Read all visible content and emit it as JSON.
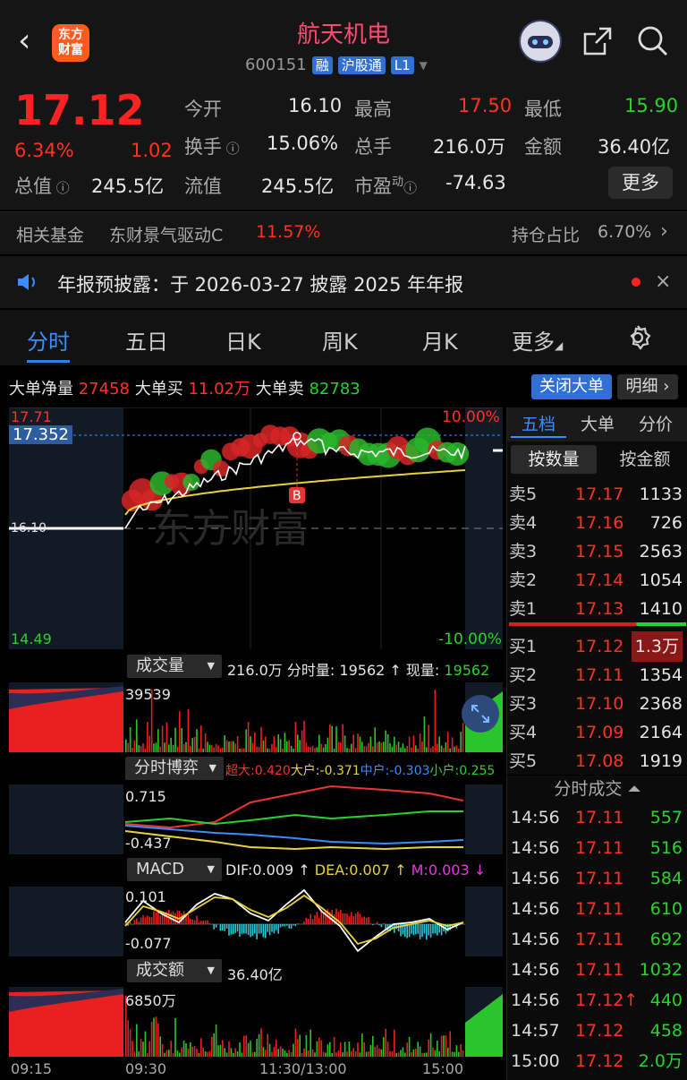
{
  "header": {
    "name": "航天机电",
    "code": "600151",
    "tags": [
      "融",
      "沪股通",
      "L1"
    ],
    "logo_text": "东方财富"
  },
  "quote": {
    "price": "17.12",
    "pct": "6.34%",
    "chg": "1.02",
    "open_l": "今开",
    "open": "16.10",
    "high_l": "最高",
    "high": "17.50",
    "low_l": "最低",
    "low": "15.90",
    "turn_l": "换手",
    "turn": "15.06%",
    "vol_l": "总手",
    "vol": "216.0万",
    "amt_l": "金额",
    "amt": "36.40亿",
    "mv_l": "总值",
    "mv": "245.5亿",
    "fmv_l": "流值",
    "fmv": "245.5亿",
    "pe_l": "市盈",
    "pe_sup": "动",
    "pe": "-74.63",
    "more": "更多"
  },
  "fund": {
    "label": "相关基金",
    "name": "东财景气驱动C",
    "pct": "11.57%",
    "hold_l": "持仓占比",
    "hold": "6.70%"
  },
  "notice": {
    "text": "年报预披露：于 2026-03-27 披露 2025 年年报"
  },
  "tabs": [
    "分时",
    "五日",
    "日K",
    "周K",
    "月K",
    "更多"
  ],
  "big_order": {
    "net_l": "大单净量",
    "net": "27458",
    "buy_l": "大单买",
    "buy": "11.02万",
    "sell_l": "大单卖",
    "sell": "82783",
    "close_btn": "关闭大单",
    "detail_btn": "明细"
  },
  "chart": {
    "top_price": "17.71",
    "top_pct": "10.00%",
    "cur_price": "17.352",
    "base_price": "16.10",
    "bottom_price": "14.49",
    "bottom_pct": "-10.00%",
    "b_marker": "B",
    "watermark": "东方财富"
  },
  "vol_panel": {
    "select": "成交量",
    "total": "216.0万",
    "fsl_l": "分时量:",
    "fsl": "19562",
    "xl_l": "现量:",
    "xl": "19562",
    "max": "39539"
  },
  "game_panel": {
    "select": "分时博弈",
    "super_l": "超大:",
    "super": "0.420",
    "big_l": "大户:",
    "big": "-0.371",
    "mid_l": "中户:",
    "mid": "-0.303",
    "small_l": "小户:",
    "small": "0.255",
    "max": "0.715",
    "min": "-0.437"
  },
  "macd_panel": {
    "select": "MACD",
    "dif": "DIF:0.009",
    "dea": "DEA:0.007",
    "m": "M:0.003",
    "max": "0.101",
    "min": "-0.077"
  },
  "amt_panel": {
    "select": "成交额",
    "total": "36.40亿",
    "max": "6850万"
  },
  "time_axis": [
    "09:15",
    "09:30",
    "11:30/13:00",
    "15:00"
  ],
  "orderbook": {
    "tabs": [
      "五档",
      "大单",
      "分价"
    ],
    "sub": [
      "按数量",
      "按金额"
    ],
    "asks": [
      {
        "l": "卖5",
        "p": "17.17",
        "v": "1133"
      },
      {
        "l": "卖4",
        "p": "17.16",
        "v": "726"
      },
      {
        "l": "卖3",
        "p": "17.15",
        "v": "2563"
      },
      {
        "l": "卖2",
        "p": "17.14",
        "v": "1054"
      },
      {
        "l": "卖1",
        "p": "17.13",
        "v": "1410"
      }
    ],
    "bids": [
      {
        "l": "买1",
        "p": "17.12",
        "v": "1.3万"
      },
      {
        "l": "买2",
        "p": "17.11",
        "v": "1354"
      },
      {
        "l": "买3",
        "p": "17.10",
        "v": "2368"
      },
      {
        "l": "买4",
        "p": "17.09",
        "v": "2164"
      },
      {
        "l": "买5",
        "p": "17.08",
        "v": "1919"
      }
    ]
  },
  "trades": {
    "title": "分时成交",
    "rows": [
      {
        "t": "14:56",
        "p": "17.11",
        "v": "557"
      },
      {
        "t": "14:56",
        "p": "17.11",
        "v": "516"
      },
      {
        "t": "14:56",
        "p": "17.11",
        "v": "584"
      },
      {
        "t": "14:56",
        "p": "17.11",
        "v": "610"
      },
      {
        "t": "14:56",
        "p": "17.11",
        "v": "692"
      },
      {
        "t": "14:56",
        "p": "17.11",
        "v": "1032"
      },
      {
        "t": "14:56",
        "p": "17.12↑",
        "v": "440"
      },
      {
        "t": "14:57",
        "p": "17.12",
        "v": "458"
      },
      {
        "t": "15:00",
        "p": "17.12",
        "v": "2.0万"
      }
    ]
  }
}
